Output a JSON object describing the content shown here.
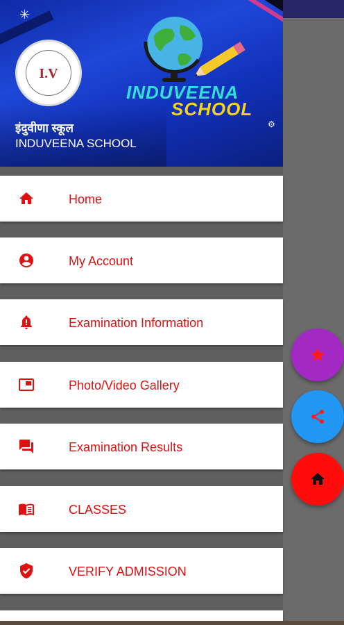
{
  "header": {
    "school_name_hindi": "इंदुवीणा स्कूल",
    "school_name_english": "INDUVEENA SCHOOL",
    "logo_text": "I.V",
    "banner_title_line1": "INDUVEENA",
    "banner_title_line2": "SCHOOL"
  },
  "menu": {
    "items": [
      {
        "label": "Home",
        "icon": "home-icon"
      },
      {
        "label": "My Account",
        "icon": "account-circle-icon"
      },
      {
        "label": "Examination Information",
        "icon": "notification-bell-icon"
      },
      {
        "label": "Photo/Video Gallery",
        "icon": "gallery-icon"
      },
      {
        "label": "Examination Results",
        "icon": "chat-results-icon"
      },
      {
        "label": "CLASSES",
        "icon": "book-icon"
      },
      {
        "label": "VERIFY ADMISSION",
        "icon": "verified-shield-icon"
      }
    ]
  },
  "fabs": [
    {
      "icon": "star-icon",
      "color": "#a229c4"
    },
    {
      "icon": "share-icon",
      "color": "#2196f3"
    },
    {
      "icon": "home-icon",
      "color": "#ff0d0d"
    }
  ],
  "colors": {
    "accent": "#e01010",
    "header_blue": "#1f47d8",
    "scrim": "#6b6b6b"
  }
}
